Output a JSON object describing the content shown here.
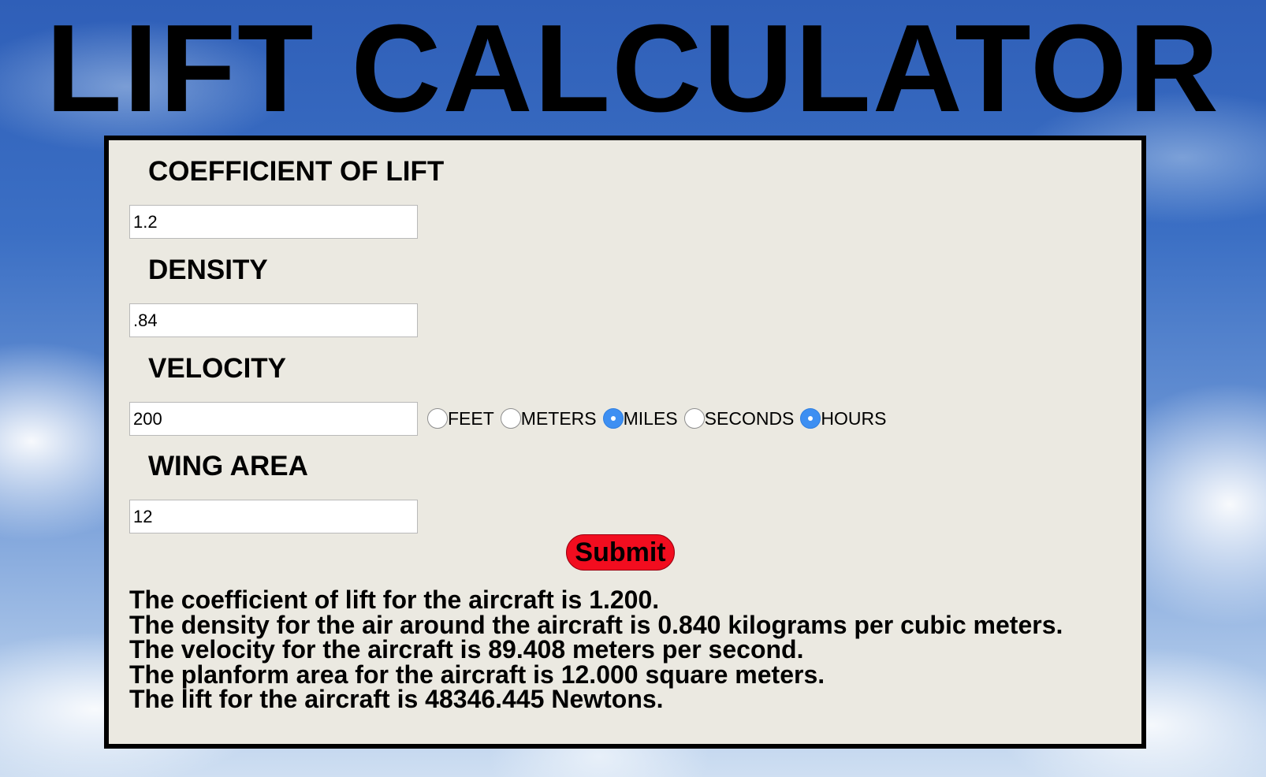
{
  "title": "LIFT CALCULATOR",
  "fields": [
    {
      "label": "COEFFICIENT OF LIFT",
      "value": "1.2"
    },
    {
      "label": "DENSITY",
      "value": ".84"
    },
    {
      "label": "VELOCITY",
      "value": "200"
    },
    {
      "label": "WING AREA",
      "value": "12"
    }
  ],
  "velocity_units": [
    {
      "label": "FEET",
      "checked": false
    },
    {
      "label": "METERS",
      "checked": false
    },
    {
      "label": "MILES",
      "checked": true
    },
    {
      "label": "SECONDS",
      "checked": false
    },
    {
      "label": "HOURS",
      "checked": true
    }
  ],
  "submit_label": "Submit",
  "results": [
    "The coefficient of lift for the aircraft is 1.200.",
    "The density for the air around the aircraft is 0.840 kilograms per cubic meters.",
    "The velocity for the aircraft is 89.408 meters per second.",
    "The planform area for the aircraft is 12.000 square meters.",
    "The lift for the aircraft is 48346.445 Newtons."
  ],
  "colors": {
    "submit": "#f20d1f",
    "radio_checked": "#3d8ff2",
    "panel": "#ebe9e1"
  }
}
